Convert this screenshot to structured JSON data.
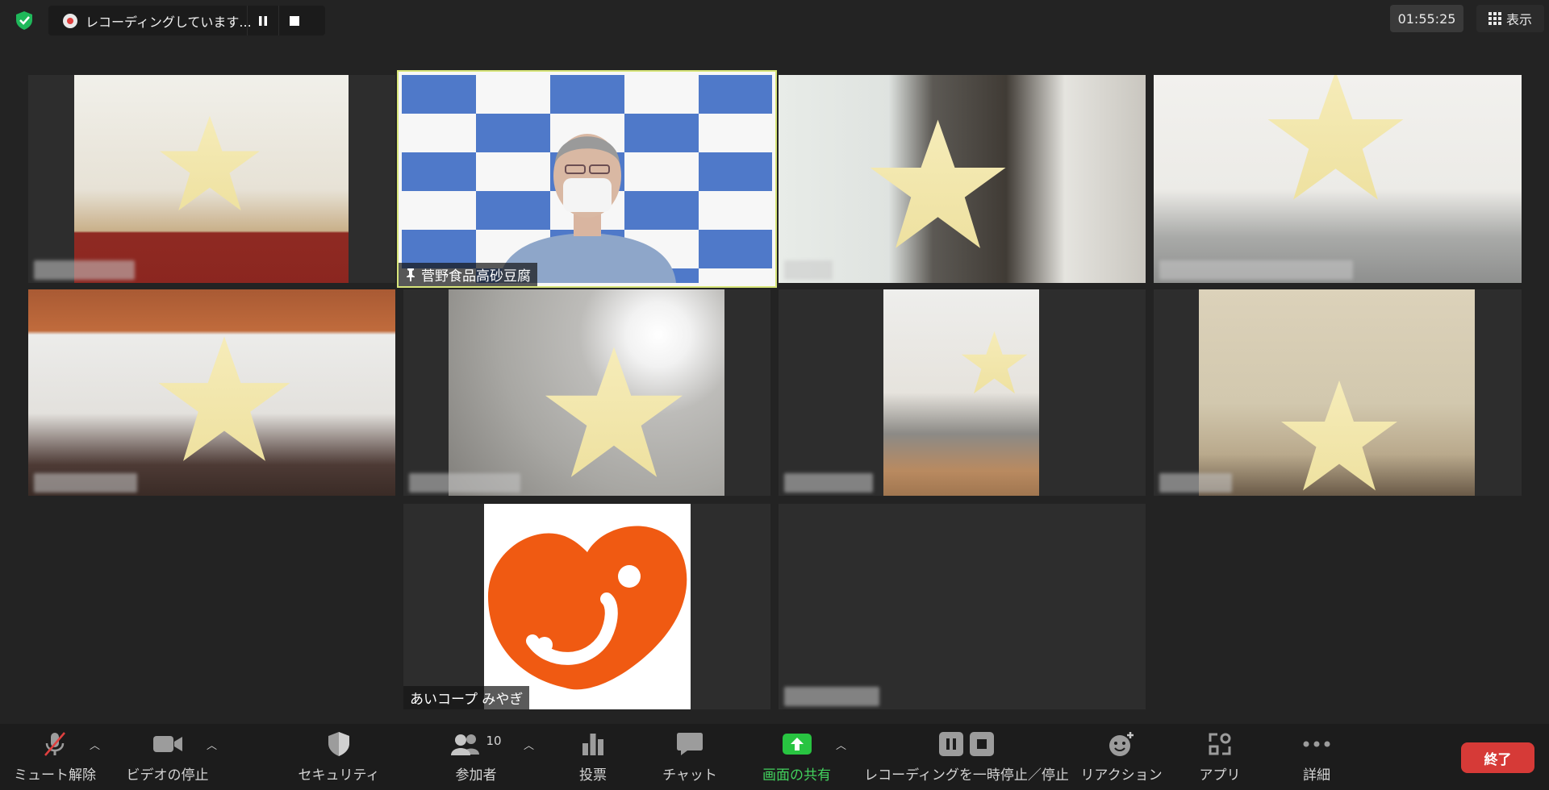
{
  "top": {
    "recording_text": "レコーディングしています...",
    "timer": "01:55:25",
    "view_label": "表示"
  },
  "tiles": [
    {
      "id": "p1",
      "name": ""
    },
    {
      "id": "p2",
      "name": "菅野食品高砂豆腐",
      "pinned": true,
      "active_speaker": true
    },
    {
      "id": "p3",
      "name": ""
    },
    {
      "id": "p4",
      "name": ""
    },
    {
      "id": "p5",
      "name": ""
    },
    {
      "id": "p6",
      "name": ""
    },
    {
      "id": "p7",
      "name": ""
    },
    {
      "id": "p8",
      "name": ""
    },
    {
      "id": "p9",
      "name": "あいコープ みやぎ"
    },
    {
      "id": "p10",
      "name": ""
    }
  ],
  "toolbar": {
    "unmute": "ミュート解除",
    "stop_video": "ビデオの停止",
    "security": "セキュリティ",
    "participants": "参加者",
    "participants_count": "10",
    "polls": "投票",
    "chat": "チャット",
    "share_screen": "画面の共有",
    "recording": "レコーディングを一時停止／停止",
    "reactions": "リアクション",
    "apps": "アプリ",
    "more": "詳細",
    "end": "終了"
  },
  "colors": {
    "background": "#232323",
    "speaker_border": "#d7e57a",
    "share_green": "#42d15d",
    "end_red": "#d63a37",
    "logo_orange": "#f05a12",
    "shield_green": "#1fb85a"
  },
  "icons": [
    "shield-check-icon",
    "record-icon",
    "pause-icon",
    "stop-icon",
    "grid-icon",
    "mic-muted-icon",
    "video-camera-icon",
    "security-shield-icon",
    "participants-icon",
    "polls-icon",
    "chat-icon",
    "share-arrow-icon",
    "reaction-icon",
    "apps-icon",
    "more-icon",
    "pin-icon"
  ]
}
